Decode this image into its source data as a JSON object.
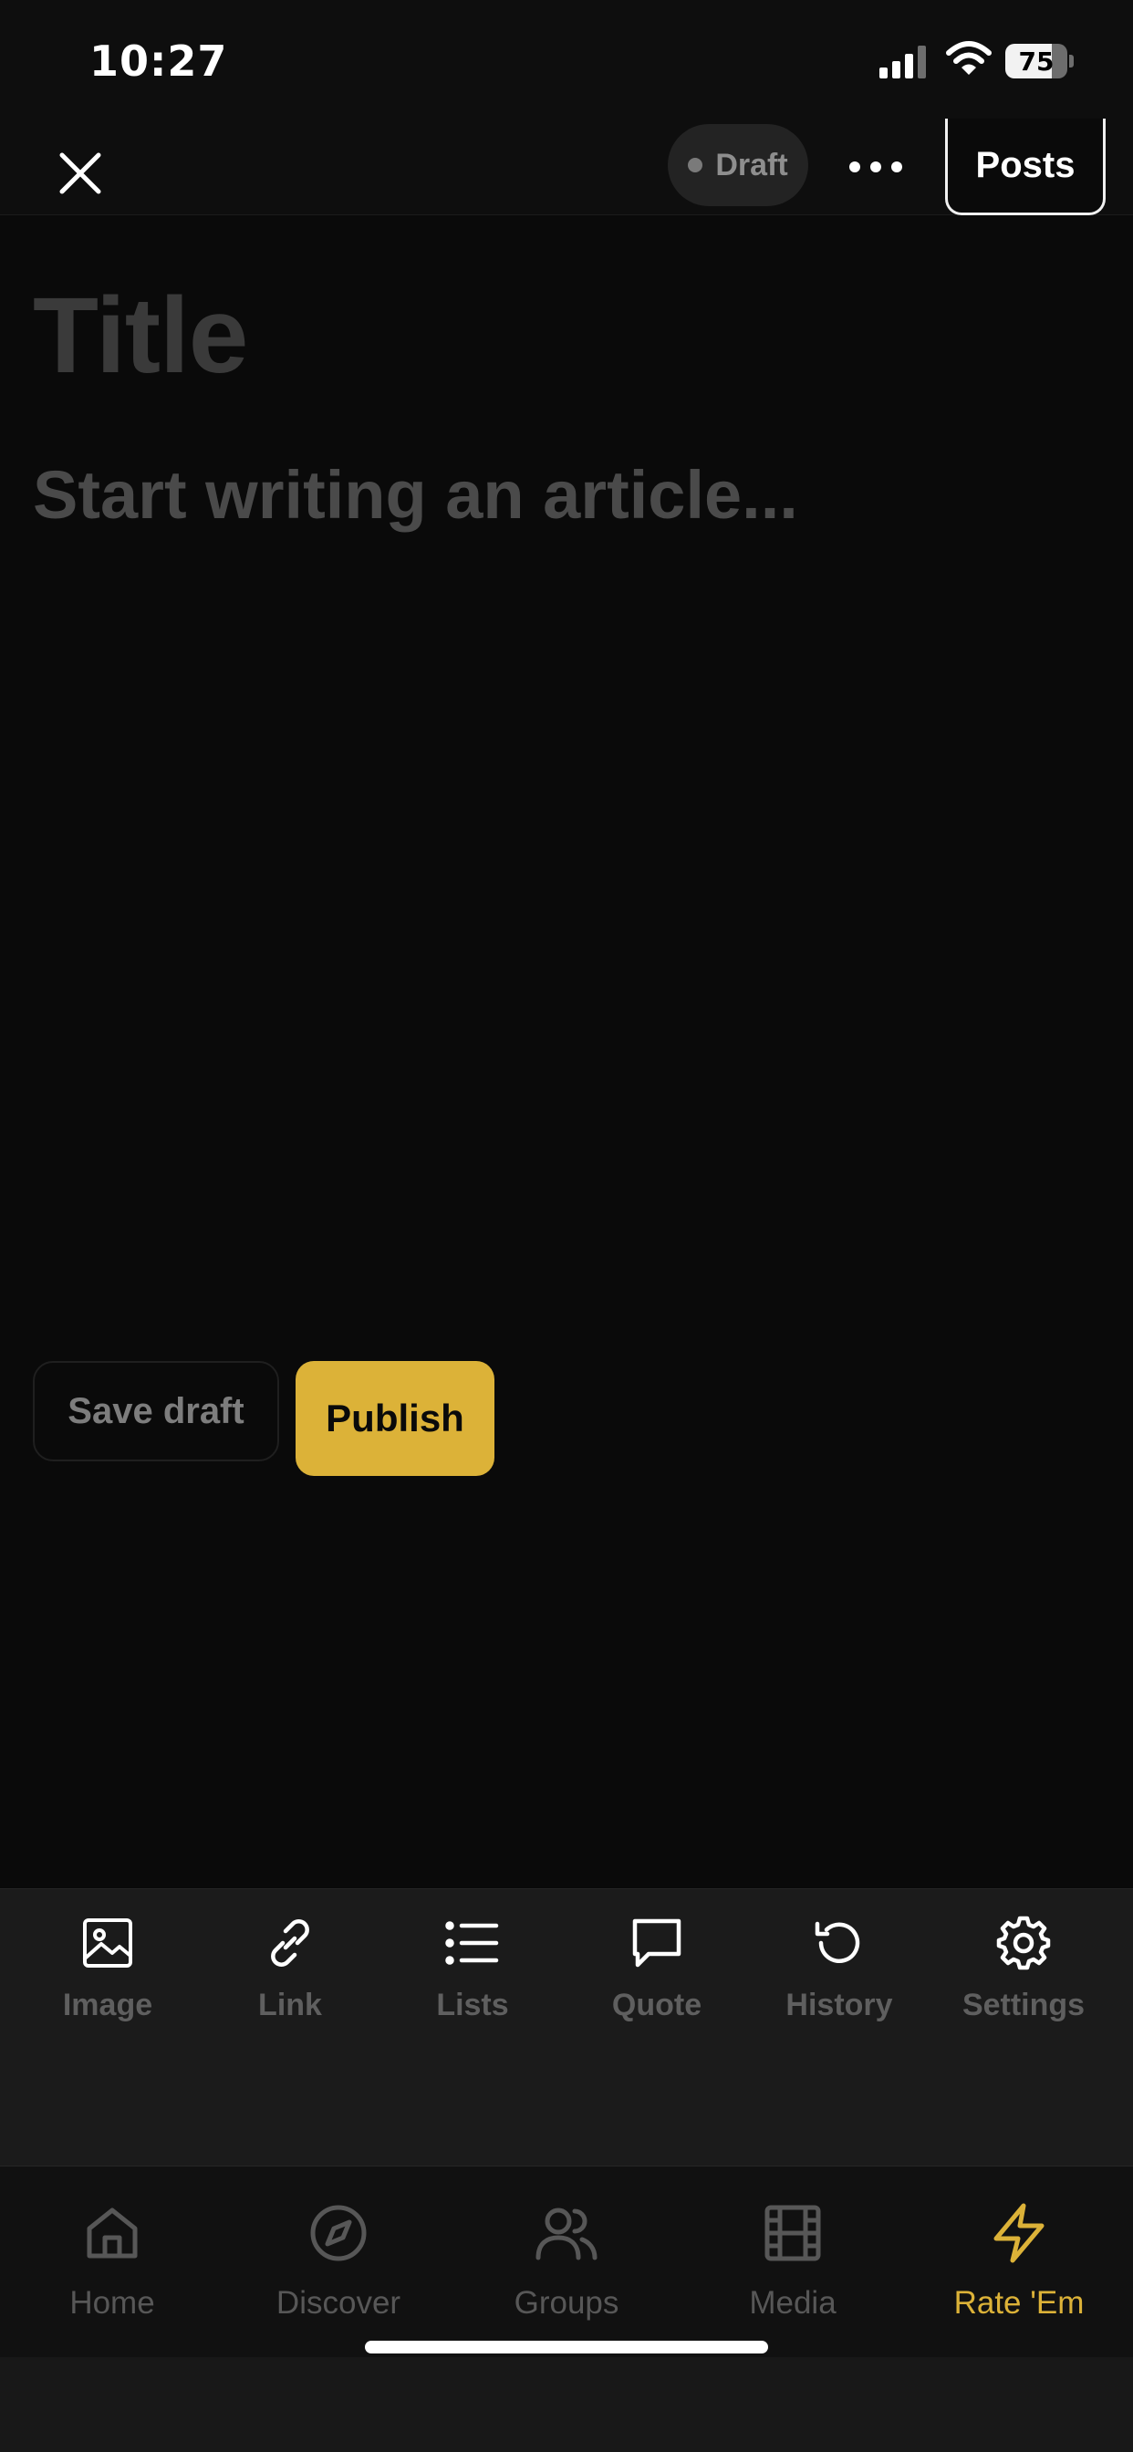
{
  "status_bar": {
    "time": "10:27",
    "battery": "75",
    "battery_level": 0.75,
    "icons": [
      "signal-icon",
      "wifi-icon",
      "battery-icon"
    ]
  },
  "top_nav": {
    "close_icon": "close-icon",
    "draft_label": "Draft",
    "more_icon": "more-icon",
    "posts_label": "Posts"
  },
  "editor": {
    "title_placeholder": "Title",
    "body_placeholder": "Start writing an article..."
  },
  "actions": {
    "save_draft_label": "Save draft",
    "publish_label": "Publish"
  },
  "toolbar": {
    "items": [
      {
        "label": "Image",
        "icon": "image-icon"
      },
      {
        "label": "Link",
        "icon": "link-icon"
      },
      {
        "label": "Lists",
        "icon": "list-icon"
      },
      {
        "label": "Quote",
        "icon": "quote-icon"
      },
      {
        "label": "History",
        "icon": "history-icon"
      },
      {
        "label": "Settings",
        "icon": "gear-icon"
      }
    ]
  },
  "tab_bar": {
    "items": [
      {
        "label": "Home",
        "icon": "home-icon"
      },
      {
        "label": "Discover",
        "icon": "compass-icon"
      },
      {
        "label": "Groups",
        "icon": "users-icon"
      },
      {
        "label": "Media",
        "icon": "film-icon"
      },
      {
        "label": "Rate 'Em",
        "icon": "lightning-icon",
        "active": true
      }
    ]
  },
  "colors": {
    "accent": "#dcb238",
    "background": "#0a0a0a",
    "toolbar": "#1b1b1b"
  }
}
